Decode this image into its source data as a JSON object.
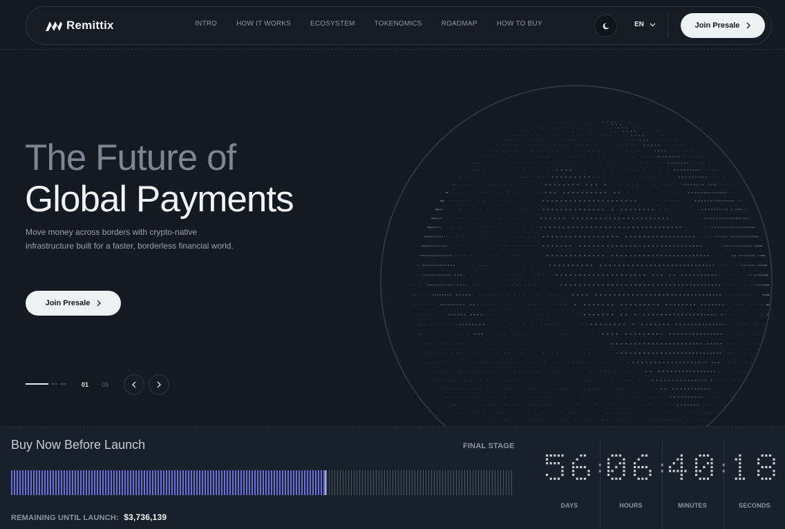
{
  "brand": {
    "name": "Remittix"
  },
  "nav": {
    "items": [
      {
        "label": "INTRO"
      },
      {
        "label": "HOW IT WORKS"
      },
      {
        "label": "ECOSYSTEM"
      },
      {
        "label": "TOKENOMICS"
      },
      {
        "label": "ROADMAP"
      },
      {
        "label": "HOW TO BUY"
      }
    ],
    "theme_icon": "moon-icon",
    "language": "EN",
    "cta_label": "Join Presale"
  },
  "hero": {
    "title_line1": "The Future of",
    "title_line2": "Global Payments",
    "subtitle": "Move money across borders with crypto-native infrastructure built for a faster, borderless financial world.",
    "cta_label": "Join Presale",
    "slide_current": "01",
    "slide_total": "03"
  },
  "presale": {
    "title": "Buy Now Before Launch",
    "stage": "FINAL STAGE",
    "progress_fraction": 0.624,
    "remaining_label": "REMAINING UNTIL LAUNCH:",
    "remaining_value": "$3,736,139"
  },
  "countdown": {
    "units": [
      {
        "value": "56",
        "label": "DAYS"
      },
      {
        "value": "06",
        "label": "HOURS"
      },
      {
        "value": "40",
        "label": "MINUTES"
      },
      {
        "value": "18",
        "label": "SECONDS"
      }
    ]
  },
  "colors": {
    "background": "#141a22",
    "accent_progress": "#6c6ee0",
    "button_bg": "#eef1f4"
  }
}
